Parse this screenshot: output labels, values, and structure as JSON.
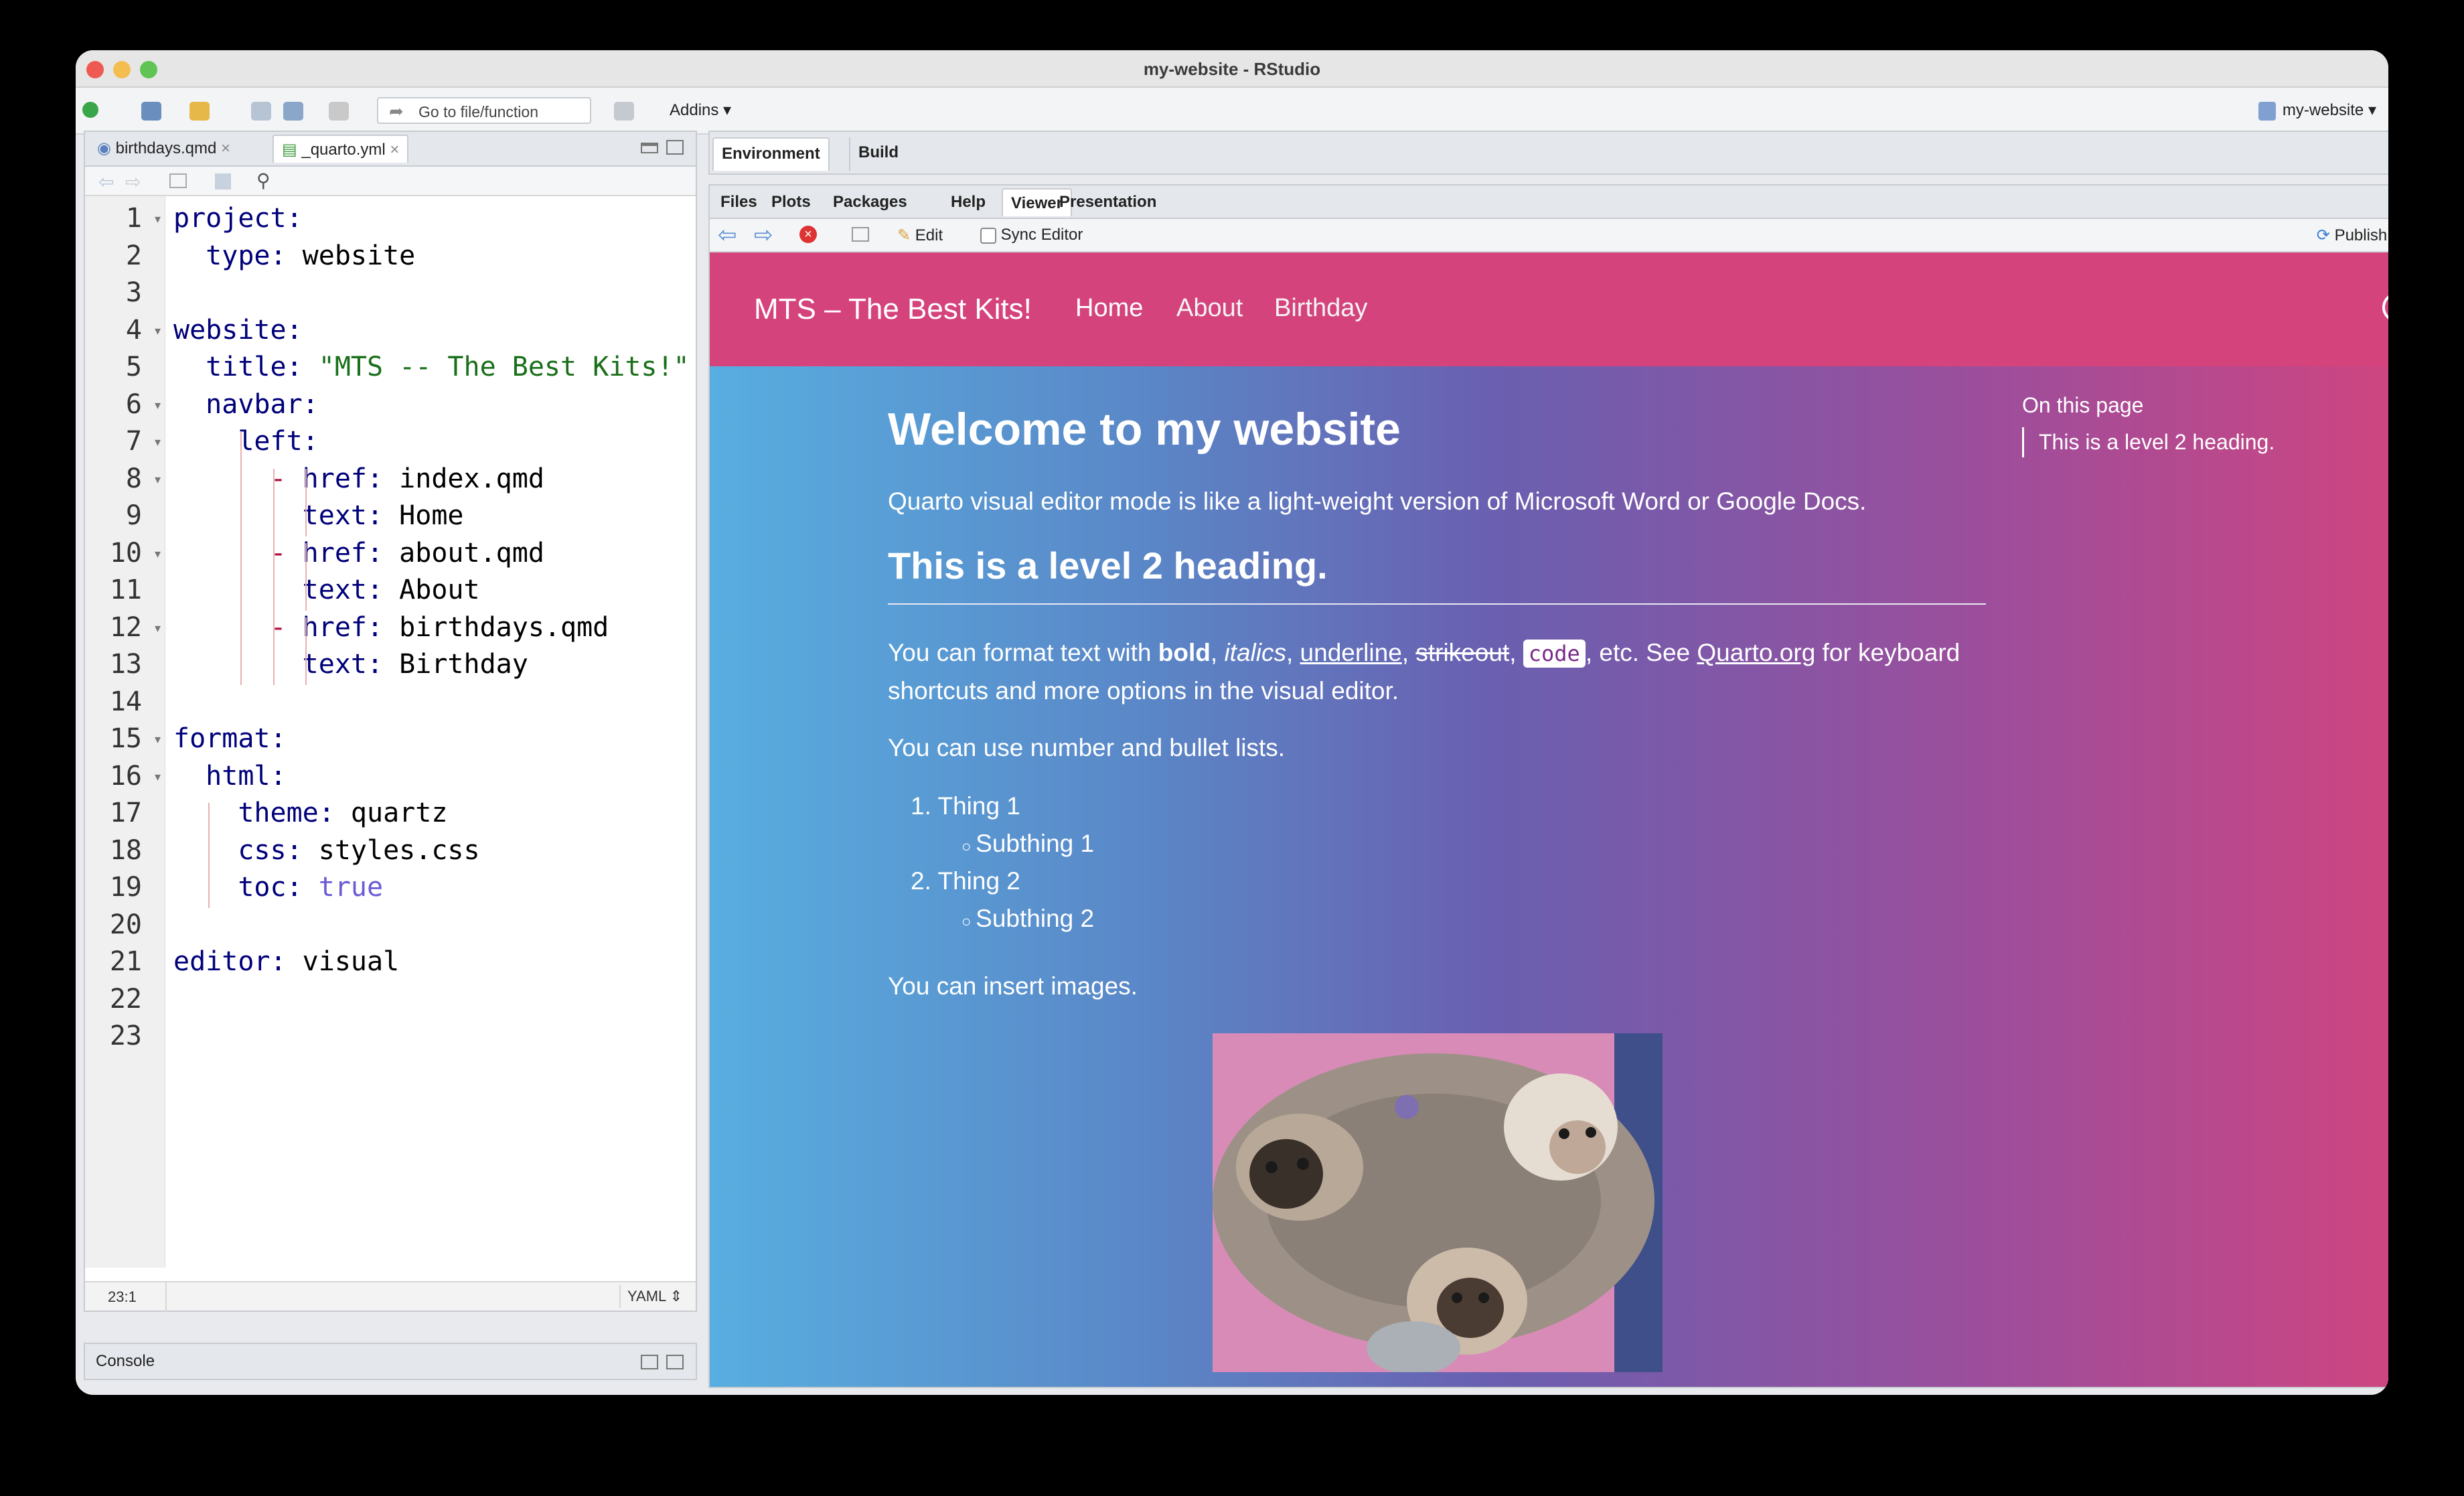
{
  "window": {
    "title": "my-website - RStudio"
  },
  "toolbar": {
    "goto_placeholder": "Go to file/function",
    "addins_label": "Addins",
    "project_label": "my-website"
  },
  "editor": {
    "tabs": [
      {
        "label": "birthdays.qmd",
        "active": false
      },
      {
        "label": "_quarto.yml",
        "active": true
      }
    ],
    "cursor_position": "23:1",
    "file_type": "YAML",
    "lines": [
      "project:",
      "  type: website",
      "",
      "website:",
      "  title: \"MTS -- The Best Kits!\"",
      "  navbar:",
      "    left:",
      "      - href: index.qmd",
      "        text: Home",
      "      - href: about.qmd",
      "        text: About",
      "      - href: birthdays.qmd",
      "        text: Birthday",
      "",
      "format:",
      "  html:",
      "    theme: quartz",
      "    css: styles.css",
      "    toc: true",
      "",
      "editor: visual",
      "",
      ""
    ]
  },
  "console": {
    "label": "Console"
  },
  "env_pane": {
    "tabs": [
      "Environment",
      "Build"
    ]
  },
  "viewer_pane": {
    "tabs": [
      "Files",
      "Plots",
      "Packages",
      "Help",
      "Viewer",
      "Presentation"
    ],
    "active_tab": "Viewer",
    "edit_label": "Edit",
    "sync_label": "Sync Editor",
    "publish_label": "Publish"
  },
  "site": {
    "brand": "MTS – The Best Kits!",
    "nav": [
      "Home",
      "About",
      "Birthday"
    ],
    "h1": "Welcome to my website",
    "intro": "Quarto visual editor mode is like a light-weight version of Microsoft Word or Google Docs.",
    "h2": "This is a level 2 heading.",
    "format_para": {
      "pre": "You can format text with ",
      "bold": "bold",
      "italics": "italics",
      "underline": "underline",
      "strike": "strikeout",
      "code": "code",
      "mid": ", etc. See ",
      "link": "Quarto.org",
      "post": " for keyboard shortcuts and more options in the visual editor."
    },
    "lists_para": "You can use number and bullet lists.",
    "list": [
      "1. Thing 1",
      "Subthing 1",
      "2. Thing 2",
      "Subthing 2"
    ],
    "images_para": "You can insert images.",
    "toc_title": "On this page",
    "toc_item": "This is a level 2 heading."
  },
  "colors": {
    "navbar": "#d5437d",
    "gradient_left": "#58aee0",
    "gradient_right": "#d5447d"
  }
}
